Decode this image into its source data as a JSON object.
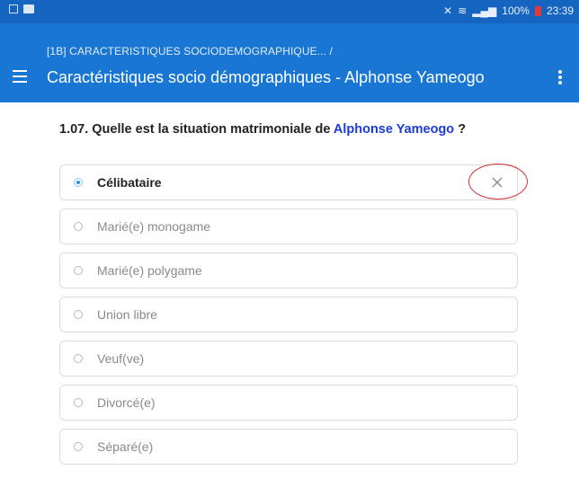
{
  "status_bar": {
    "battery": "100%",
    "time": "23:39"
  },
  "app_bar": {
    "breadcrumb": "[1B] CARACTERISTIQUES SOCIODEMOGRAPHIQUE... /",
    "title": "Caractéristiques socio démographiques - Alphonse Yameogo"
  },
  "question": {
    "prefix": "1.07. Quelle est la situation matrimoniale de ",
    "name": "Alphonse Yameogo",
    "suffix": " ?",
    "selected_index": 0,
    "options": [
      "Célibataire",
      "Marié(e) monogame",
      "Marié(e) polygame",
      "Union libre",
      "Veuf(ve)",
      "Divorcé(e)",
      "Séparé(e)"
    ]
  },
  "colors": {
    "status_bar": "#1565c0",
    "app_bar": "#1976d2",
    "name_highlight": "#1a3bd6",
    "radio_selected": "#2196f3",
    "annotation": "#d32f2f"
  }
}
